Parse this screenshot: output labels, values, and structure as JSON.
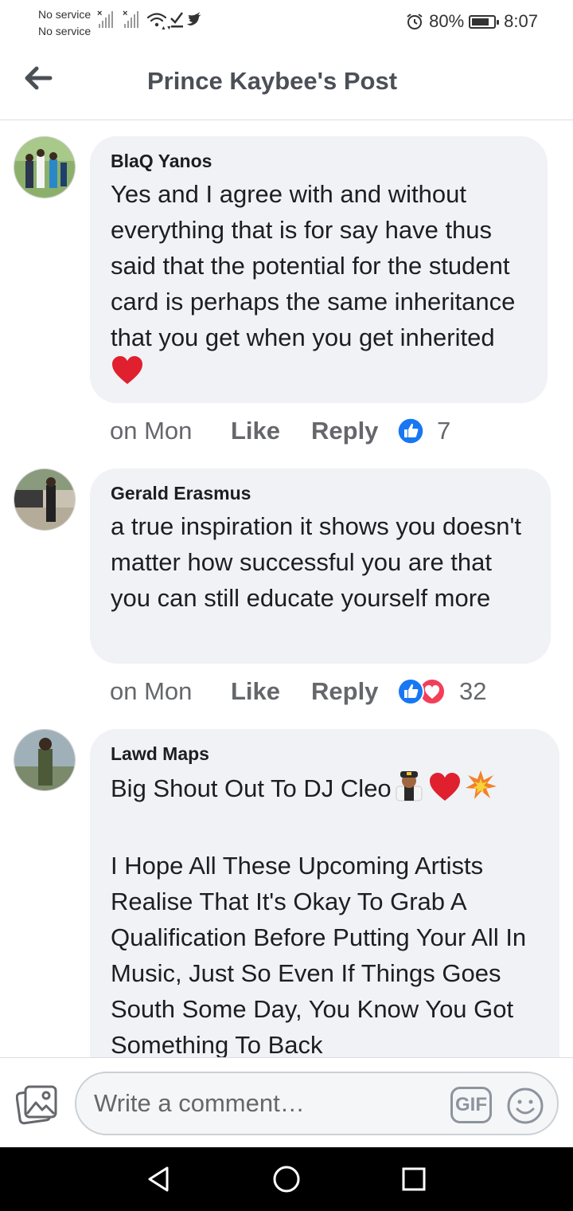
{
  "status_bar": {
    "sim1": "No service",
    "sim2": "No service",
    "alarm_icon": "alarm-clock-icon",
    "battery_percent": "80%",
    "battery_level": 0.8,
    "time": "8:07"
  },
  "header": {
    "title": "Prince Kaybee's Post",
    "back_icon": "back-arrow-icon"
  },
  "comments": [
    {
      "author": "BlaQ Yanos",
      "text": "Yes and I agree with and without everything that is for say have thus said that the potential for the student card is perhaps the same inheritance that you get when you get inherited",
      "emoji": "❤️",
      "time": "on Mon",
      "like_label": "Like",
      "reply_label": "Reply",
      "reactions": [
        "like"
      ],
      "reaction_count": "7"
    },
    {
      "author": "Gerald Erasmus",
      "text": "a true inspiration it shows you doesn't matter how successful you are that you can still educate yourself more",
      "time": "on Mon",
      "like_label": "Like",
      "reply_label": "Reply",
      "reactions": [
        "like",
        "love"
      ],
      "reaction_count": "32"
    },
    {
      "author": "Lawd Maps",
      "line1": "Big Shout Out To DJ Cleo",
      "line1_emoji": "👨‍✈️❤️💥",
      "text": "I Hope All These Upcoming Artists Realise That It's Okay To Grab A Qualification Before Putting Your All In Music, Just So Even If Things Goes South Some Day, You Know You Got Something To Back"
    }
  ],
  "composer": {
    "placeholder": "Write a comment…",
    "gif_label": "GIF",
    "photo_icon": "photo-icon",
    "emoji_icon": "smiley-icon"
  },
  "colors": {
    "bubble": "#f0f2f5",
    "like_blue": "#1877f2",
    "love_red": "#f33e58",
    "meta_gray": "#65676b"
  }
}
